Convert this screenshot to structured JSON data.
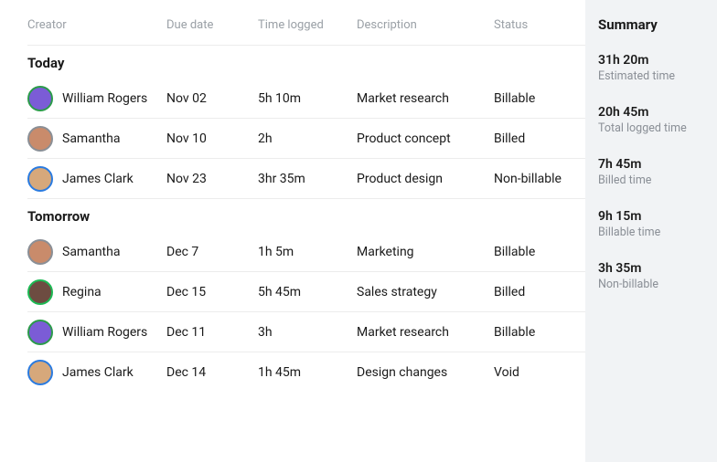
{
  "columns": {
    "creator": "Creator",
    "due": "Due date",
    "time": "Time logged",
    "desc": "Description",
    "status": "Status"
  },
  "groups": {
    "today": "Today",
    "tomorrow": "Tomorrow"
  },
  "rows": {
    "today": [
      {
        "creator": "William Rogers",
        "avatar": "william",
        "due": "Nov 02",
        "time": "5h 10m",
        "desc": "Market research",
        "status": "Billable"
      },
      {
        "creator": "Samantha",
        "avatar": "samantha",
        "due": "Nov 10",
        "time": "2h",
        "desc": "Product concept",
        "status": "Billed"
      },
      {
        "creator": "James Clark",
        "avatar": "james",
        "due": "Nov 23",
        "time": "3hr 35m",
        "desc": "Product design",
        "status": "Non-billable"
      }
    ],
    "tomorrow": [
      {
        "creator": "Samantha",
        "avatar": "samantha",
        "due": "Dec 7",
        "time": "1h 5m",
        "desc": "Marketing",
        "status": "Billable"
      },
      {
        "creator": "Regina",
        "avatar": "regina",
        "due": "Dec 15",
        "time": "5h 45m",
        "desc": "Sales strategy",
        "status": "Billed"
      },
      {
        "creator": "William Rogers",
        "avatar": "william",
        "due": "Dec 11",
        "time": "3h",
        "desc": "Market research",
        "status": "Billable"
      },
      {
        "creator": "James Clark",
        "avatar": "james",
        "due": "Dec 14",
        "time": "1h 45m",
        "desc": "Design changes",
        "status": "Void"
      }
    ]
  },
  "summary": {
    "title": "Summary",
    "items": [
      {
        "value": "31h 20m",
        "label": "Estimated time"
      },
      {
        "value": "20h 45m",
        "label": "Total logged time"
      },
      {
        "value": "7h 45m",
        "label": "Billed time"
      },
      {
        "value": "9h 15m",
        "label": "Billable time"
      },
      {
        "value": "3h 35m",
        "label": "Non-billable"
      }
    ]
  }
}
